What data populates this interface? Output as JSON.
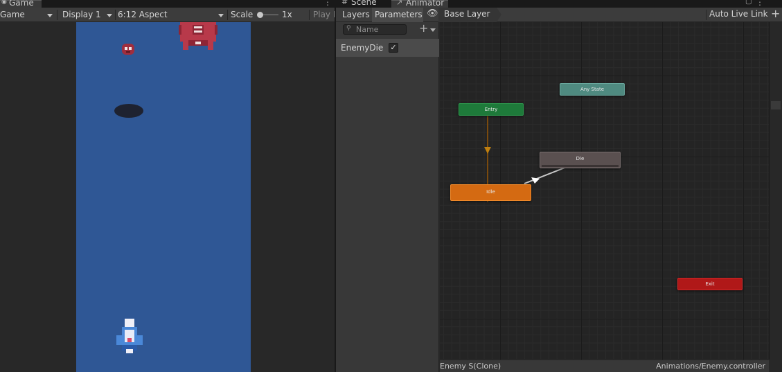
{
  "game_window": {
    "tab_label": "Game",
    "game_dropdown": "Game",
    "display_dropdown": "Display 1",
    "aspect_dropdown": "6:12 Aspect",
    "scale_label": "Scale",
    "scale_value": "1x",
    "play_focused_label": "Play F"
  },
  "animator_window": {
    "scene_tab_label": "Scene",
    "animator_tab_label": "Animator",
    "layers_tab": "Layers",
    "parameters_tab": "Parameters",
    "breadcrumb": "Base Layer",
    "auto_live_link": "Auto Live Link",
    "search_placeholder": "Name",
    "parameters": [
      {
        "name": "EnemyDie",
        "type": "bool",
        "value": true
      }
    ],
    "states": {
      "entry": "Entry",
      "any_state": "Any State",
      "die": "Die",
      "idle": "Idle",
      "exit": "Exit"
    },
    "status_left": "Enemy S(Clone)",
    "status_right": "Animations/Enemy.controller"
  },
  "colors": {
    "game_background": "#2f5795",
    "entry_node": "#1e7a3a",
    "any_state_node": "#4f8a80",
    "idle_node": "#d46a12",
    "die_node": "#5a5050",
    "exit_node": "#b01818"
  }
}
